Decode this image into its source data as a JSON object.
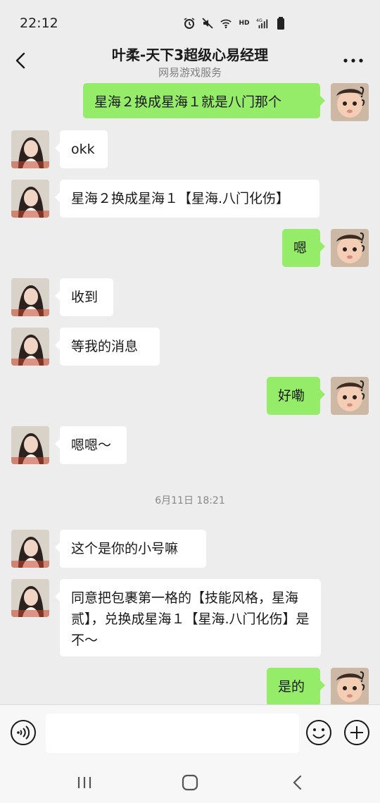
{
  "status_bar": {
    "time": "22:12",
    "icons": [
      "alarm-icon",
      "mute-icon",
      "wifi-icon",
      "hd-label",
      "signal-4g-icon",
      "battery-icon"
    ],
    "hd_text": "HD"
  },
  "header": {
    "title": "叶柔-天下3超级心易经理",
    "subtitle": "网易游戏服务",
    "back_icon": "chevron-left-icon",
    "more_icon": "more-dots-icon"
  },
  "messages": [
    {
      "side": "out",
      "text": "星海２换成星海１就是八门那个"
    },
    {
      "side": "in",
      "text": "okk"
    },
    {
      "side": "in",
      "text": "星海２换成星海１【星海.八门化伤】"
    },
    {
      "side": "out",
      "text": "嗯"
    },
    {
      "side": "in",
      "text": "收到"
    },
    {
      "side": "in",
      "text": "等我的消息"
    },
    {
      "side": "out",
      "text": "好嘞"
    },
    {
      "side": "in",
      "text": "嗯嗯～"
    },
    {
      "side": "time",
      "text": "6月11日 18:21"
    },
    {
      "side": "in",
      "text": "这个是你的小号嘛"
    },
    {
      "side": "in",
      "text": "同意把包裹第一格的【技能风格，星海贰】，兑换成星海１【星海.八门化伤】是不～"
    },
    {
      "side": "out",
      "text": "是的"
    }
  ],
  "input_bar": {
    "voice_icon": "voice-icon",
    "input_value": "",
    "emoji_icon": "emoji-icon",
    "plus_icon": "plus-icon"
  },
  "system_nav": {
    "recents_icon": "recent-apps-icon",
    "home_icon": "home-icon",
    "back_icon": "back-icon"
  },
  "colors": {
    "background": "#ededed",
    "outgoing_bubble": "#95ec69",
    "incoming_bubble": "#ffffff"
  }
}
